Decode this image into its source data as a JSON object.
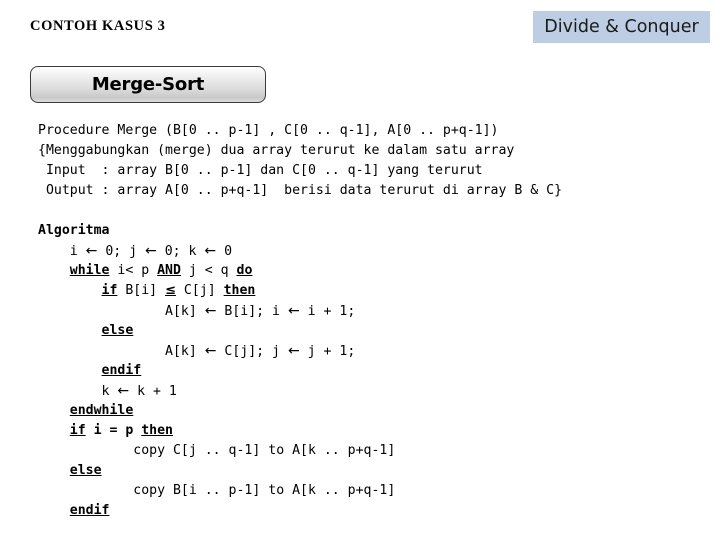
{
  "slide": {
    "title": "CONTOH KASUS 3",
    "topic_badge": "Divide & Conquer",
    "badge_color": "#bdcee4",
    "heading_button": "Merge-Sort",
    "background_color": "#ffffff",
    "text_color": "#000000"
  },
  "procedure_header": {
    "lines": [
      "Procedure Merge (B[0 .. p-1] , C[0 .. q-1], A[0 .. p+q-1])",
      "{Menggabungkan (merge) dua array terurut ke dalam satu array",
      " Input  : array B[0 .. p-1] dan C[0 .. q-1] yang terurut",
      " Output : array A[0 .. p+q-1]  berisi data terurut di array B & C}"
    ]
  },
  "algorithm": {
    "heading": "Algoritma",
    "lines": [
      {
        "indent": 0,
        "segments": [
          {
            "t": "Algoritma",
            "s": "bold"
          }
        ]
      },
      {
        "indent": 1,
        "segments": [
          {
            "t": "i "
          },
          {
            "t": "←",
            "s": "arrow"
          },
          {
            "t": " 0; j "
          },
          {
            "t": "←",
            "s": "arrow"
          },
          {
            "t": " 0; k "
          },
          {
            "t": "←",
            "s": "arrow"
          },
          {
            "t": " 0"
          }
        ]
      },
      {
        "indent": 1,
        "segments": [
          {
            "t": "while",
            "s": "kw"
          },
          {
            "t": " i< p "
          },
          {
            "t": "AND",
            "s": "kw"
          },
          {
            "t": " j < q "
          },
          {
            "t": "do",
            "s": "kw"
          }
        ]
      },
      {
        "indent": 2,
        "segments": [
          {
            "t": "if",
            "s": "kw"
          },
          {
            "t": " B[i] "
          },
          {
            "t": "≤",
            "s": "le"
          },
          {
            "t": " C[j] "
          },
          {
            "t": "then",
            "s": "kw"
          }
        ]
      },
      {
        "indent": 4,
        "segments": [
          {
            "t": "A[k] "
          },
          {
            "t": "←",
            "s": "arrow"
          },
          {
            "t": " B[i]; i "
          },
          {
            "t": "←",
            "s": "arrow"
          },
          {
            "t": " i + 1;"
          }
        ]
      },
      {
        "indent": 2,
        "segments": [
          {
            "t": "else",
            "s": "kw"
          }
        ]
      },
      {
        "indent": 4,
        "segments": [
          {
            "t": "A[k] "
          },
          {
            "t": "←",
            "s": "arrow"
          },
          {
            "t": " C[j]; j "
          },
          {
            "t": "←",
            "s": "arrow"
          },
          {
            "t": " j + 1;"
          }
        ]
      },
      {
        "indent": 2,
        "segments": [
          {
            "t": "endif",
            "s": "kw"
          }
        ]
      },
      {
        "indent": 2,
        "segments": [
          {
            "t": "k "
          },
          {
            "t": "←",
            "s": "arrow"
          },
          {
            "t": " k + 1"
          }
        ]
      },
      {
        "indent": 1,
        "segments": [
          {
            "t": "endwhile",
            "s": "kw"
          }
        ]
      },
      {
        "indent": 1,
        "segments": [
          {
            "t": "if",
            "s": "kw"
          },
          {
            "t": " i = p ",
            "s": "bold"
          },
          {
            "t": "then",
            "s": "kw"
          }
        ]
      },
      {
        "indent": 3,
        "segments": [
          {
            "t": "copy C[j .. q-1] to A[k .. p+q-1]"
          }
        ]
      },
      {
        "indent": 1,
        "segments": [
          {
            "t": "else",
            "s": "kw"
          }
        ]
      },
      {
        "indent": 3,
        "segments": [
          {
            "t": "copy B[i .. p-1] to A[k .. p+q-1]"
          }
        ]
      },
      {
        "indent": 1,
        "segments": [
          {
            "t": "endif",
            "s": "kw"
          }
        ]
      }
    ]
  }
}
